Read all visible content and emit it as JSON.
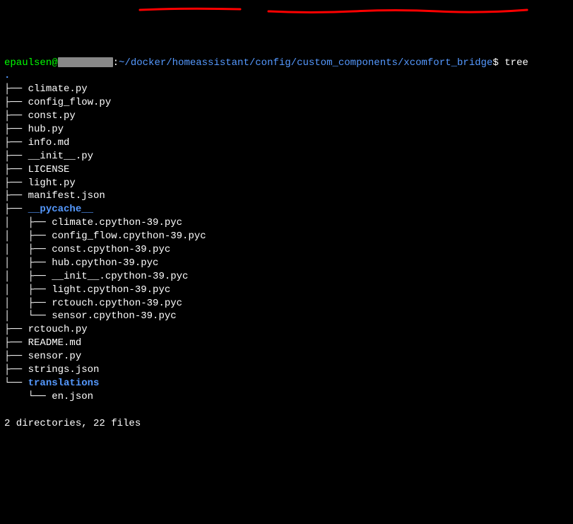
{
  "prompt": {
    "user": "epaulsen",
    "at": "@",
    "host_hidden": true,
    "colon": ":",
    "path": "~/docker/homeassistant/config/custom_components/xcomfort_bridge",
    "dollar": "$",
    "command": "tree"
  },
  "dot": ".",
  "tree": [
    {
      "prefix": "├── ",
      "name": "climate.py",
      "type": "file"
    },
    {
      "prefix": "├── ",
      "name": "config_flow.py",
      "type": "file"
    },
    {
      "prefix": "├── ",
      "name": "const.py",
      "type": "file"
    },
    {
      "prefix": "├── ",
      "name": "hub.py",
      "type": "file"
    },
    {
      "prefix": "├── ",
      "name": "info.md",
      "type": "file"
    },
    {
      "prefix": "├── ",
      "name": "__init__.py",
      "type": "file"
    },
    {
      "prefix": "├── ",
      "name": "LICENSE",
      "type": "file"
    },
    {
      "prefix": "├── ",
      "name": "light.py",
      "type": "file"
    },
    {
      "prefix": "├── ",
      "name": "manifest.json",
      "type": "file"
    },
    {
      "prefix": "├── ",
      "name": "__pycache__",
      "type": "dir"
    },
    {
      "prefix": "│   ├── ",
      "name": "climate.cpython-39.pyc",
      "type": "file"
    },
    {
      "prefix": "│   ├── ",
      "name": "config_flow.cpython-39.pyc",
      "type": "file"
    },
    {
      "prefix": "│   ├── ",
      "name": "const.cpython-39.pyc",
      "type": "file"
    },
    {
      "prefix": "│   ├── ",
      "name": "hub.cpython-39.pyc",
      "type": "file"
    },
    {
      "prefix": "│   ├── ",
      "name": "__init__.cpython-39.pyc",
      "type": "file"
    },
    {
      "prefix": "│   ├── ",
      "name": "light.cpython-39.pyc",
      "type": "file"
    },
    {
      "prefix": "│   ├── ",
      "name": "rctouch.cpython-39.pyc",
      "type": "file"
    },
    {
      "prefix": "│   └── ",
      "name": "sensor.cpython-39.pyc",
      "type": "file"
    },
    {
      "prefix": "├── ",
      "name": "rctouch.py",
      "type": "file"
    },
    {
      "prefix": "├── ",
      "name": "README.md",
      "type": "file"
    },
    {
      "prefix": "├── ",
      "name": "sensor.py",
      "type": "file"
    },
    {
      "prefix": "├── ",
      "name": "strings.json",
      "type": "file"
    },
    {
      "prefix": "└── ",
      "name": "translations",
      "type": "dir"
    },
    {
      "prefix": "    └── ",
      "name": "en.json",
      "type": "file"
    }
  ],
  "summary": "2 directories, 22 files"
}
